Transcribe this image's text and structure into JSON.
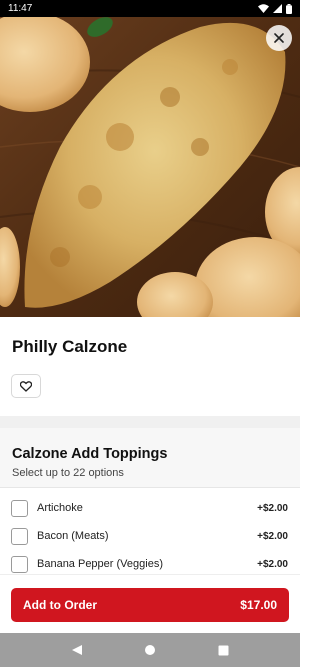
{
  "status_bar": {
    "time": "11:47"
  },
  "item": {
    "title": "Philly Calzone"
  },
  "toppings": {
    "title": "Calzone Add Toppings",
    "subtitle": "Select up to 22 options",
    "options": [
      {
        "label": "Artichoke",
        "price": "+$2.00"
      },
      {
        "label": "Bacon (Meats)",
        "price": "+$2.00"
      },
      {
        "label": "Banana Pepper (Veggies)",
        "price": "+$2.00"
      }
    ]
  },
  "footer": {
    "add_label": "Add to Order",
    "price": "$17.00"
  },
  "colors": {
    "accent": "#d0161f",
    "status_bar": "#000000",
    "nav_bar": "#9e9e9e"
  },
  "icons": {
    "close": "close-icon",
    "favorite": "heart-icon",
    "back": "back-triangle-icon",
    "home": "home-circle-icon",
    "recents": "recents-square-icon"
  }
}
